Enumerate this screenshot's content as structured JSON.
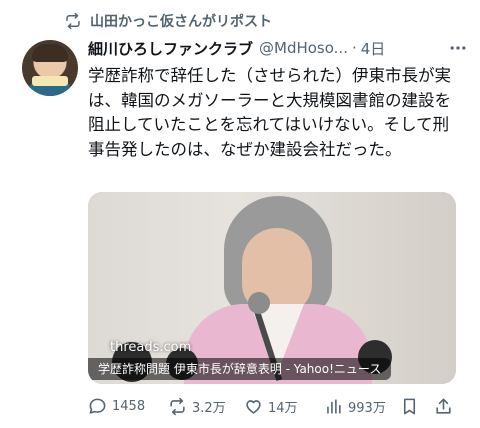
{
  "repost": {
    "label": "山田かっこ仮さんがリポスト",
    "icon": "repost-icon"
  },
  "author": {
    "name": "細川ひろしファンクラブ",
    "handle": "@MdHoso...",
    "dot": "·",
    "time": "4日"
  },
  "body": "学歴詐称で辞任した（させられた）伊東市長が実は、韓国のメガソーラーと大規模図書館の建設を阻止していたことを忘れてはいけない。そして刑事告発したのは、なぜか建設会社だった。",
  "media": {
    "overlay_label": "threads.com",
    "caption": "学歴詐称問題 伊東市長が辞意表明 - Yahoo!ニュース"
  },
  "actions": {
    "replies": "1458",
    "reposts": "3.2万",
    "likes": "14万",
    "views": "993万"
  },
  "colors": {
    "secondary_text": "#536471",
    "primary_text": "#0f1419"
  }
}
